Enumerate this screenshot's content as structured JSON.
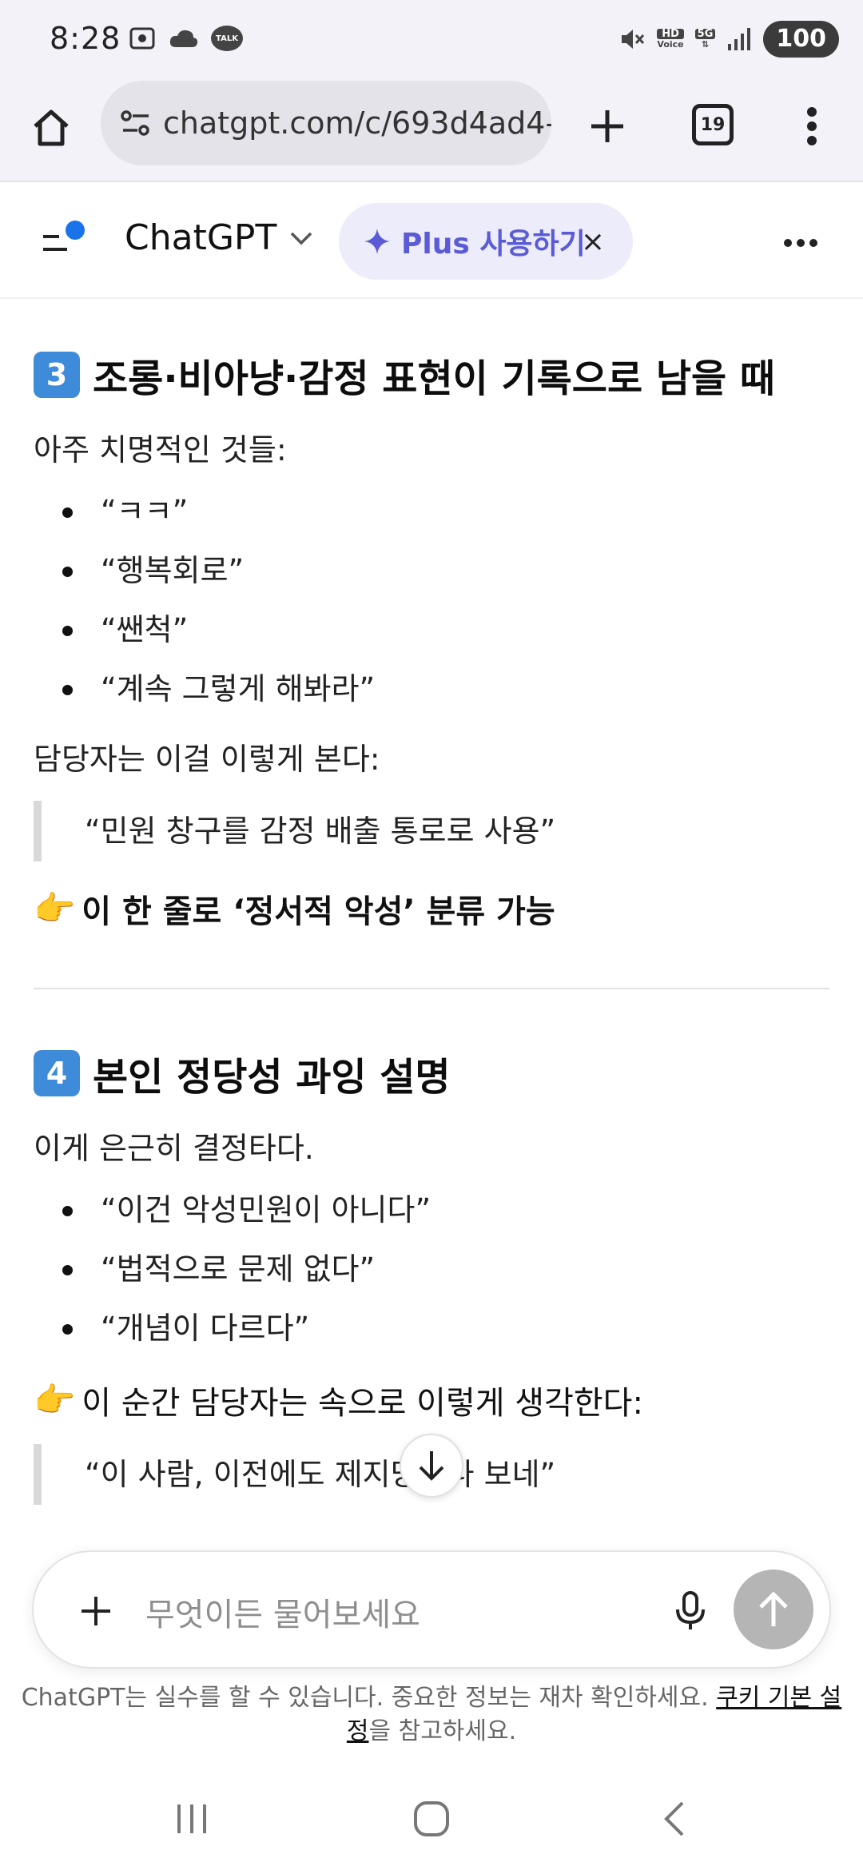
{
  "status_bar": {
    "time": "8:28",
    "talk_badge": "TALK",
    "hd_badge_top": "HD",
    "hd_badge_bottom": "Voice",
    "network": "5G",
    "battery": "100"
  },
  "browser": {
    "url": "chatgpt.com/c/693d4ad4-(",
    "tab_count": "19"
  },
  "header": {
    "model_name": "ChatGPT",
    "plus_label": "Plus 사용하기",
    "plus_close": "×"
  },
  "sections": [
    {
      "number": "3",
      "title": "조롱·비아냥·감정 표현이 기록으로 남을 때",
      "intro": "아주 치명적인 것들:",
      "bullets": [
        "“ㅋㅋ”",
        "“행복회로”",
        "“쌘척”",
        "“계속 그렇게 해봐라”"
      ],
      "follow": "담당자는 이걸 이렇게 본다:",
      "quote": "“민원 창구를 감정 배출 통로로 사용”",
      "point": "이 한 줄로 ‘정서적 악성’ 분류 가능"
    },
    {
      "number": "4",
      "title": "본인 정당성 과잉 설명",
      "intro": "이게 은근히 결정타다.",
      "bullets": [
        "“이건 악성민원이 아니다”",
        "“법적으로 문제 없다”",
        "“개념이 다르다”"
      ],
      "point": "이 순간 담당자는 속으로 이렇게 생각한다:",
      "quote": "“이 사람, 이전에도 제지당했나 보네”"
    }
  ],
  "composer": {
    "placeholder": "무엇이든 물어보세요"
  },
  "disclaimer": {
    "text": "ChatGPT는 실수를 할 수 있습니다. 중요한 정보는 재차 확인하세요. ",
    "link": "쿠키 기본 설정",
    "suffix": "을 참고하세요."
  },
  "colors": {
    "accent": "#5b5bd6",
    "keycap": "#3d8bd9",
    "notification_dot": "#1a73e8",
    "send_disabled": "#b5b5b5"
  },
  "icons": {
    "home": "home-icon",
    "site_settings": "tune-icon",
    "new_tab": "plus-icon",
    "browser_menu": "kebab-icon",
    "sidebar": "sidebar-icon",
    "sparkle": "sparkle-icon",
    "more": "more-horizontal-icon",
    "scroll_down": "arrow-down-icon",
    "attach": "plus-icon",
    "mic": "mic-icon",
    "send": "arrow-up-icon",
    "point": "pointing-hand-emoji"
  }
}
